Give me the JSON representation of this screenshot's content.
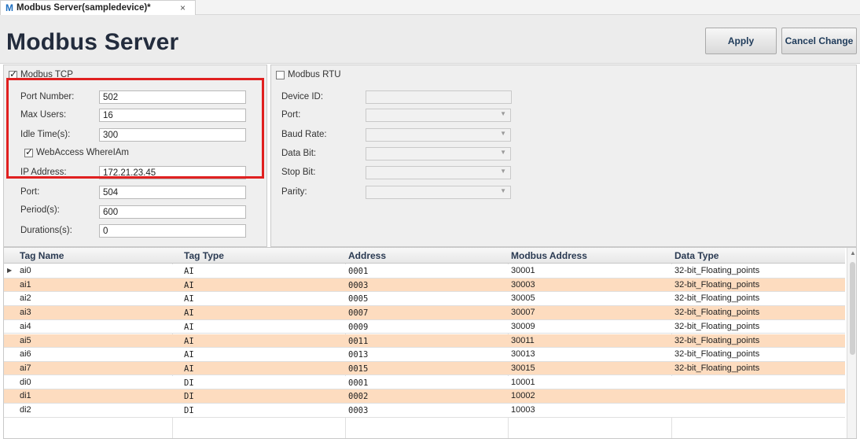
{
  "tab": {
    "logo": "M",
    "title": "Modbus Server(sampledevice)*",
    "close": "×"
  },
  "header": {
    "title": "Modbus Server",
    "apply": "Apply",
    "cancel": "Cancel Change"
  },
  "tcp": {
    "label": "Modbus TCP",
    "checked": true,
    "fields": [
      {
        "label": "Port Number:",
        "value": "502"
      },
      {
        "label": "Max Users:",
        "value": "16"
      },
      {
        "label": "Idle Time(s):",
        "value": "300"
      }
    ],
    "whereiam": {
      "label": "WebAccess WhereIAm",
      "checked": true,
      "fields": [
        {
          "label": "IP Address:",
          "value": "172.21.23.45"
        },
        {
          "label": "Port:",
          "value": "504"
        },
        {
          "label": "Period(s):",
          "value": "600"
        },
        {
          "label": "Durations(s):",
          "value": "0"
        }
      ]
    }
  },
  "rtu": {
    "label": "Modbus RTU",
    "checked": false,
    "fields": [
      {
        "label": "Device ID:"
      },
      {
        "label": "Port:"
      },
      {
        "label": "Baud Rate:"
      },
      {
        "label": "Data Bit:"
      },
      {
        "label": "Stop Bit:"
      },
      {
        "label": "Parity:"
      }
    ]
  },
  "grid": {
    "columns": [
      "Tag Name",
      "Tag Type",
      "Address",
      "Modbus Address",
      "Data Type"
    ],
    "rows": [
      [
        "ai0",
        "AI",
        "0001",
        "30001",
        "32-bit_Floating_points"
      ],
      [
        "ai1",
        "AI",
        "0003",
        "30003",
        "32-bit_Floating_points"
      ],
      [
        "ai2",
        "AI",
        "0005",
        "30005",
        "32-bit_Floating_points"
      ],
      [
        "ai3",
        "AI",
        "0007",
        "30007",
        "32-bit_Floating_points"
      ],
      [
        "ai4",
        "AI",
        "0009",
        "30009",
        "32-bit_Floating_points"
      ],
      [
        "ai5",
        "AI",
        "0011",
        "30011",
        "32-bit_Floating_points"
      ],
      [
        "ai6",
        "AI",
        "0013",
        "30013",
        "32-bit_Floating_points"
      ],
      [
        "ai7",
        "AI",
        "0015",
        "30015",
        "32-bit_Floating_points"
      ],
      [
        "di0",
        "DI",
        "0001",
        "10001",
        ""
      ],
      [
        "di1",
        "DI",
        "0002",
        "10002",
        ""
      ],
      [
        "di2",
        "DI",
        "0003",
        "10003",
        ""
      ]
    ]
  },
  "colors": {
    "highlight": "#e02020",
    "row_alt": "#fddcbf",
    "title": "#232c3d"
  }
}
